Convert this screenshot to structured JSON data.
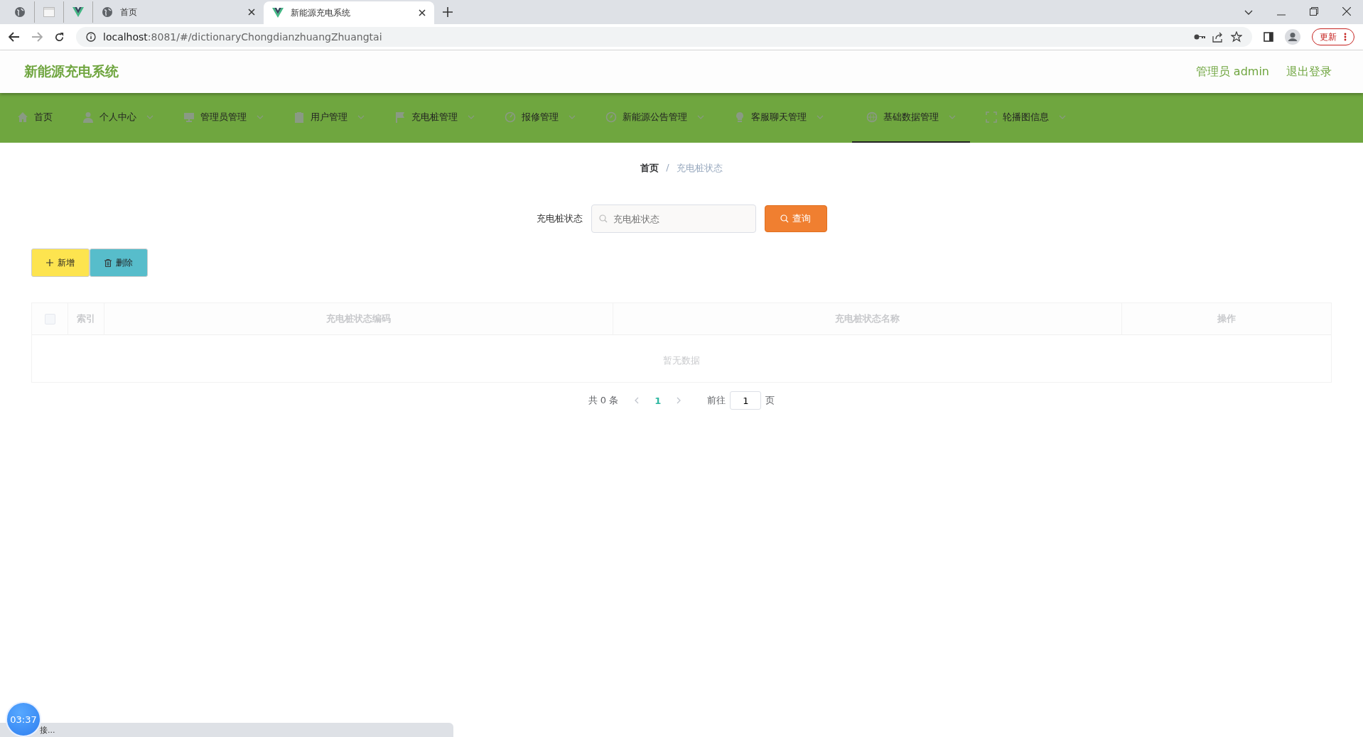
{
  "browser": {
    "tabs": [
      {
        "kind": "globe",
        "selected": false
      },
      {
        "kind": "blank",
        "selected": false
      },
      {
        "kind": "vue",
        "selected": false
      },
      {
        "kind": "globe",
        "title": "首页",
        "selected": false
      },
      {
        "kind": "vue",
        "title": "新能源充电系统",
        "selected": true
      }
    ],
    "url_host": "localhost",
    "url_rest": ":8081/#/dictionaryChongdianzhuangZhuangtai",
    "update_label": "更新"
  },
  "header": {
    "logo": "新能源充电系统",
    "user": "管理员 admin",
    "logout": "退出登录"
  },
  "nav": [
    {
      "label": "首页",
      "has_menu": false,
      "selected": false
    },
    {
      "label": "个人中心",
      "has_menu": true,
      "selected": false
    },
    {
      "label": "管理员管理",
      "has_menu": true,
      "selected": false
    },
    {
      "label": "用户管理",
      "has_menu": true,
      "selected": false
    },
    {
      "label": "充电桩管理",
      "has_menu": true,
      "selected": false
    },
    {
      "label": "报修管理",
      "has_menu": true,
      "selected": false
    },
    {
      "label": "新能源公告管理",
      "has_menu": true,
      "selected": false
    },
    {
      "label": "客服聊天管理",
      "has_menu": true,
      "selected": false
    },
    {
      "label": "基础数据管理",
      "has_menu": true,
      "selected": true
    },
    {
      "label": "轮播图信息",
      "has_menu": true,
      "selected": false
    }
  ],
  "breadcrumb": [
    "首页",
    "充电桩状态"
  ],
  "breadcrumb_separator": "/",
  "search": {
    "label": "充电桩状态",
    "placeholder": "充电桩状态",
    "button": "查询"
  },
  "actions": [
    {
      "kind": "add",
      "label": "新增"
    },
    {
      "kind": "delete",
      "label": "删除"
    }
  ],
  "table": {
    "select_all": false,
    "columns": [
      "索引",
      "充电桩状态编码",
      "充电桩状态名称",
      "操作"
    ],
    "empty_text": "暂无数据"
  },
  "pagination": {
    "total": "共 0 条",
    "pages": [
      {
        "label": "1",
        "selected": true
      }
    ],
    "goto_label": "前往",
    "goto_value": "1",
    "goto_unit": "页"
  },
  "timer": "03:37",
  "status_bar": "接..."
}
